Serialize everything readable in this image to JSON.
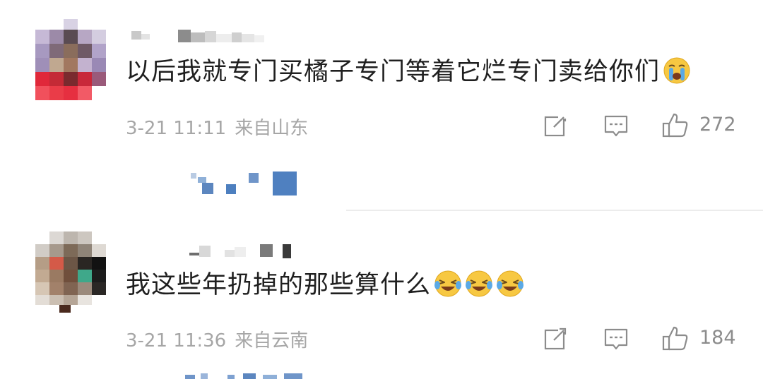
{
  "comments": [
    {
      "username": "",
      "text": "以后我就专门买橘子专门等着它烂专门卖给你们",
      "emoji": "crying-face",
      "date": "3-21 11:11",
      "location": "来自山东",
      "like_count": "272"
    },
    {
      "username": "",
      "text": "我这些年扔掉的那些算什么",
      "emoji": "laughing-crying-face",
      "date": "3-21 11:36",
      "location": "来自云南",
      "like_count": "184"
    }
  ],
  "colors": {
    "text": "#1f1f1f",
    "meta": "#a6a6a6",
    "icon": "#8c8c8c",
    "reply_link": "#4d7fbf",
    "emoji_yellow": "#f7c842",
    "emoji_tear": "#5aa9e6"
  },
  "icons": [
    "share-icon",
    "reply-icon",
    "like-icon"
  ]
}
